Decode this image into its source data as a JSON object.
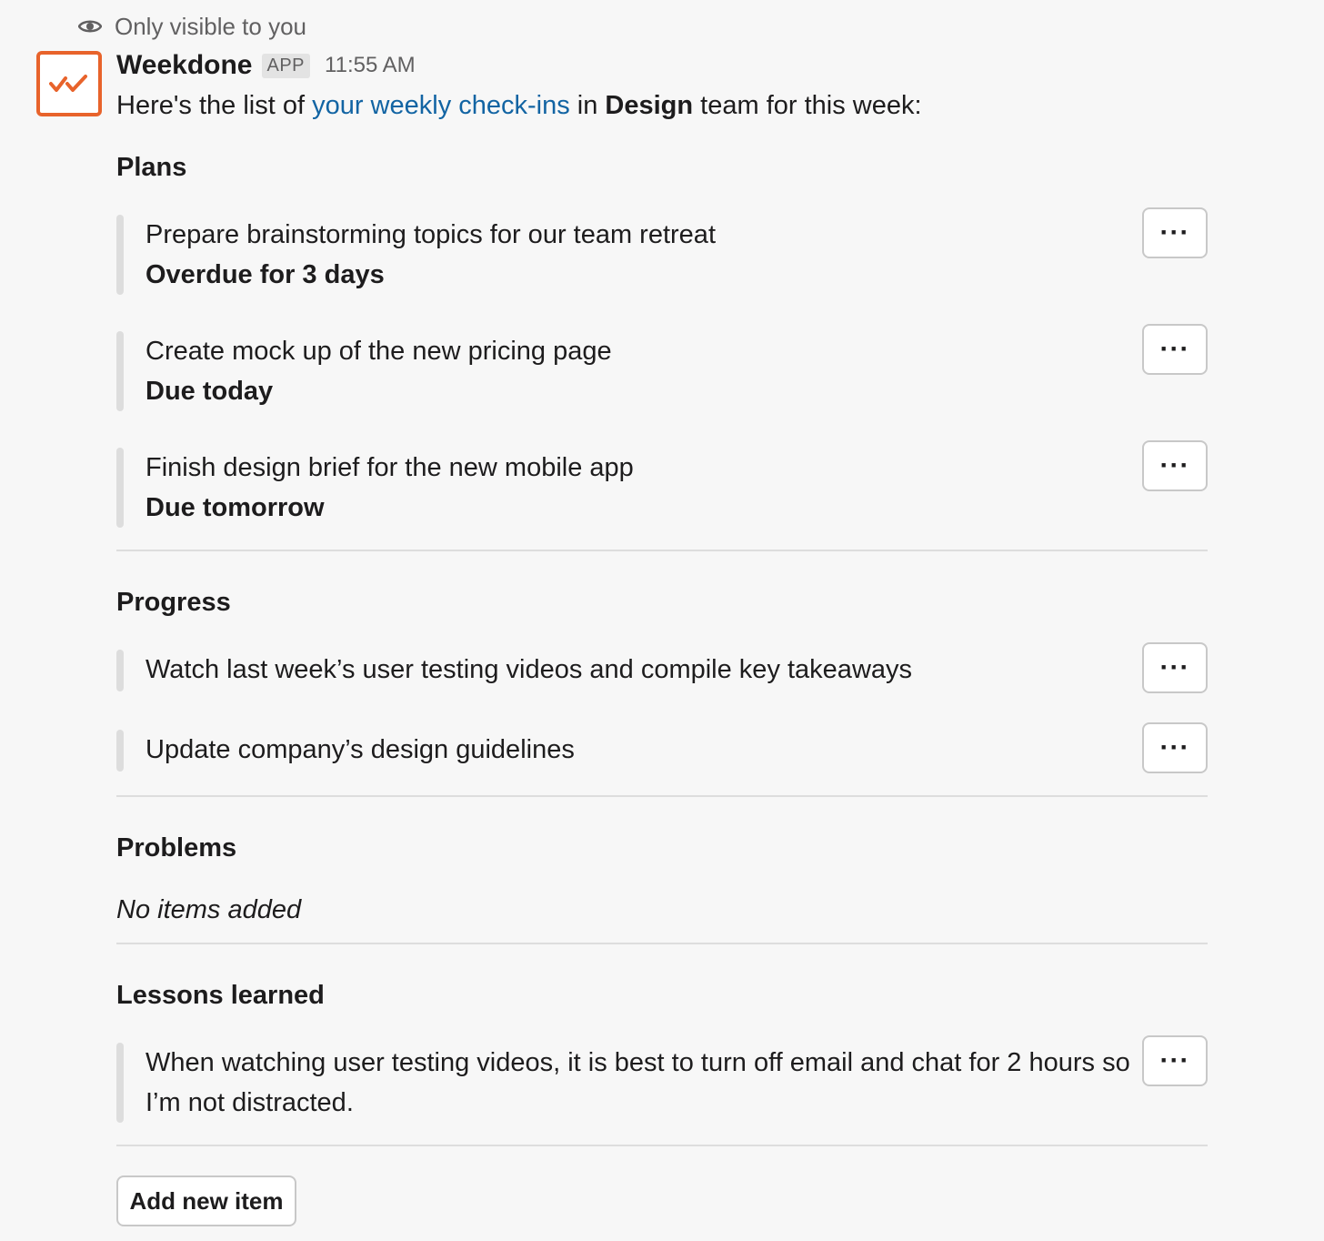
{
  "visibility": {
    "label": "Only visible to you",
    "icon": "eye-icon"
  },
  "message": {
    "app_name": "Weekdone",
    "badge": "APP",
    "timestamp": "11:55 AM",
    "avatar_icon": "double-check-icon",
    "accent_color": "#e8632b",
    "link_color": "#1264a3",
    "intro": {
      "prefix": "Here's the list of ",
      "link": "your weekly check-ins",
      "middle": " in ",
      "team": "Design",
      "suffix": " team for this week:"
    }
  },
  "sections": {
    "plans": {
      "title": "Plans",
      "items": [
        {
          "text": "Prepare brainstorming topics for our team retreat",
          "status": "Overdue for 3 days",
          "menu": "···"
        },
        {
          "text": "Create mock up of the new pricing page",
          "status": "Due today",
          "menu": "···"
        },
        {
          "text": "Finish design brief for the new mobile app",
          "status": "Due tomorrow",
          "menu": "···"
        }
      ]
    },
    "progress": {
      "title": "Progress",
      "items": [
        {
          "text": "Watch last week’s user testing videos and compile key takeaways",
          "menu": "···"
        },
        {
          "text": "Update company’s design guidelines",
          "menu": "···"
        }
      ]
    },
    "problems": {
      "title": "Problems",
      "empty": "No items added"
    },
    "lessons": {
      "title": "Lessons learned",
      "items": [
        {
          "text": "When watching user testing videos, it is best to turn off email and chat for 2 hours so I’m not distracted.",
          "menu": "···"
        }
      ]
    }
  },
  "add_button": "Add new item"
}
